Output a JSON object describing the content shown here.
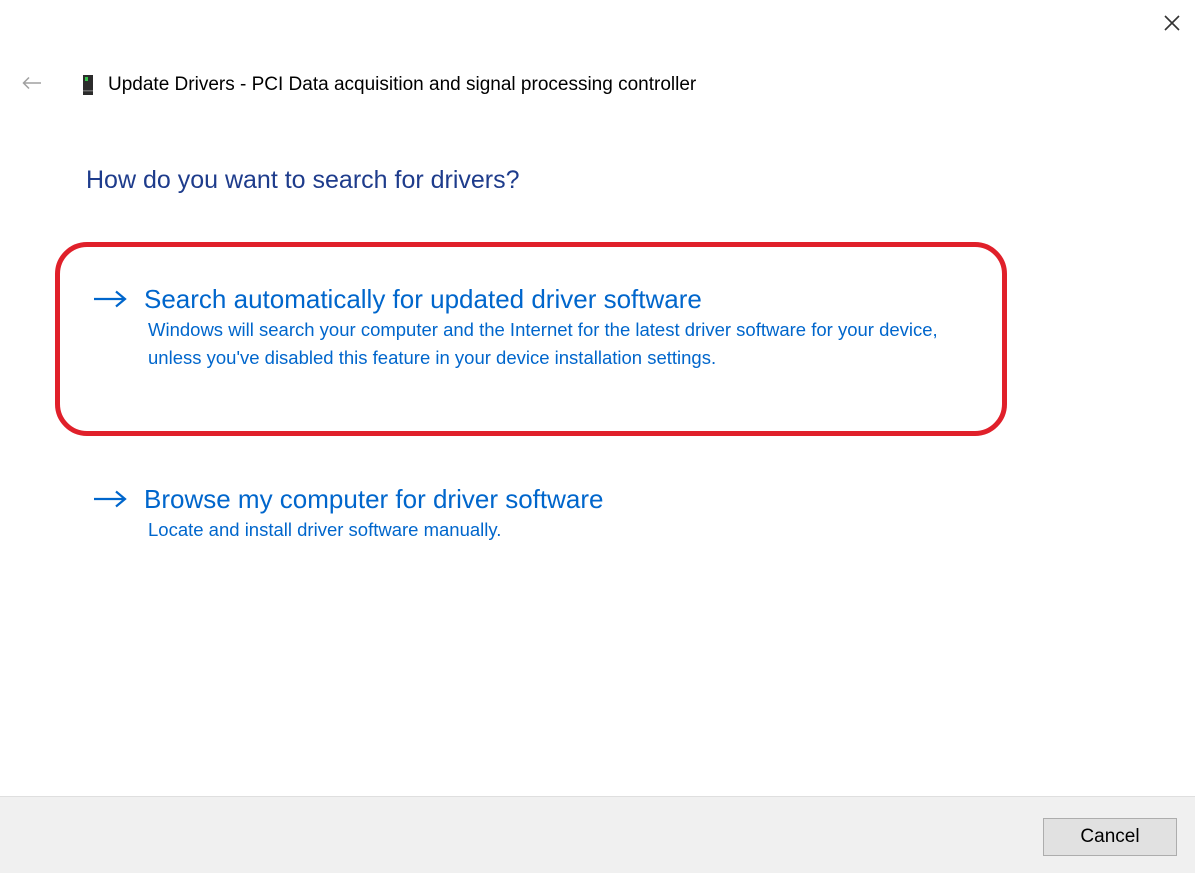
{
  "window": {
    "title_prefix": "Update Drivers - ",
    "title_device": "PCI Data acquisition and signal processing controller",
    "back_icon": "back-arrow-icon",
    "close_icon": "close-icon",
    "device_icon": "pci-device-icon"
  },
  "main": {
    "heading": "How do you want to search for drivers?",
    "options": [
      {
        "title": "Search automatically for updated driver software",
        "description": "Windows will search your computer and the Internet for the latest driver software for your device, unless you've disabled this feature in your device installation settings.",
        "icon": "right-arrow-icon",
        "highlighted": true
      },
      {
        "title": "Browse my computer for driver software",
        "description": "Locate and install driver software manually.",
        "icon": "right-arrow-icon",
        "highlighted": false
      }
    ]
  },
  "footer": {
    "cancel_label": "Cancel"
  },
  "colors": {
    "heading": "#1e3c8c",
    "link": "#0066cc",
    "highlight": "#e0202a",
    "footer_bg": "#f0f0f0"
  }
}
